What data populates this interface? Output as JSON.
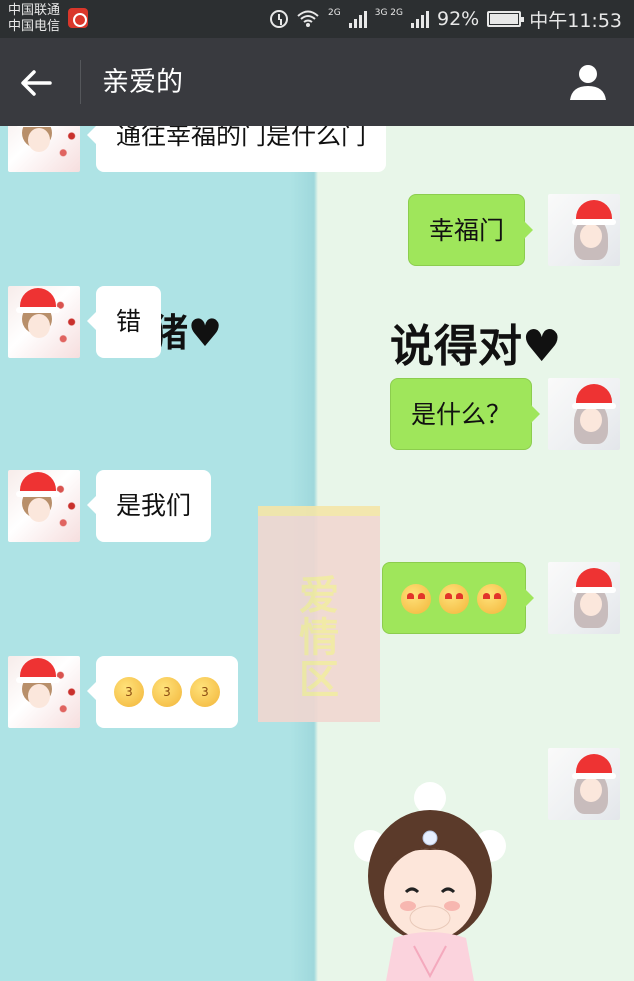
{
  "status_bar": {
    "carrier_1": "中国联通",
    "carrier_2": "中国电信",
    "net_1": "2G",
    "net_2": "3G 2G",
    "battery": "92%",
    "battery_level": 0.92,
    "time": "中午11:53"
  },
  "header": {
    "title": "亲爱的",
    "back_icon": "arrow-left-icon",
    "profile_icon": "person-icon"
  },
  "messages": [
    {
      "side": "left",
      "text": "通往幸福的门是什么门"
    },
    {
      "side": "right",
      "text": "幸福门"
    },
    {
      "side": "left",
      "text": "错"
    },
    {
      "side": "right",
      "text": "是什么？"
    },
    {
      "side": "left",
      "text": "是我们"
    },
    {
      "side": "right",
      "emojis": [
        "heart-eyes",
        "heart-eyes",
        "heart-eyes"
      ]
    },
    {
      "side": "left",
      "emojis": [
        "kiss",
        "kiss",
        "kiss"
      ]
    }
  ],
  "stickers": {
    "left_overlay": "猪♥",
    "right_caption": "说得对♥",
    "stamp": "爱情区"
  },
  "colors": {
    "left_bg": "#aee3e5",
    "right_bg": "#e8f6e9",
    "sent_bubble": "#9fe65b",
    "received_bubble": "#ffffff",
    "title_bar": "#393a3f"
  }
}
